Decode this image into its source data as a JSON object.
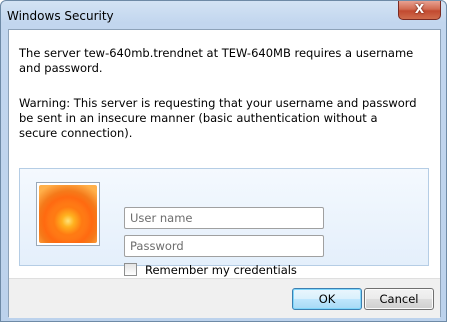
{
  "window": {
    "title": "Windows Security",
    "close_label": "X"
  },
  "message": {
    "line1": "The server tew-640mb.trendnet at TEW-640MB requires a username and password.",
    "warning": "Warning: This server is requesting that your username and password be sent in an insecure manner (basic authentication without a secure connection)."
  },
  "credentials": {
    "username_placeholder": "User name",
    "username_value": "",
    "password_placeholder": "Password",
    "password_value": "",
    "remember_label": "Remember my credentials",
    "remember_checked": false,
    "avatar_icon": "flower-user-tile-icon"
  },
  "buttons": {
    "ok_label": "OK",
    "cancel_label": "Cancel"
  },
  "colors": {
    "title_gradient": "#c2d6ee",
    "close_button": "#c24a30",
    "panel_background": "#e4effb",
    "ok_border": "#3c7fb1"
  }
}
